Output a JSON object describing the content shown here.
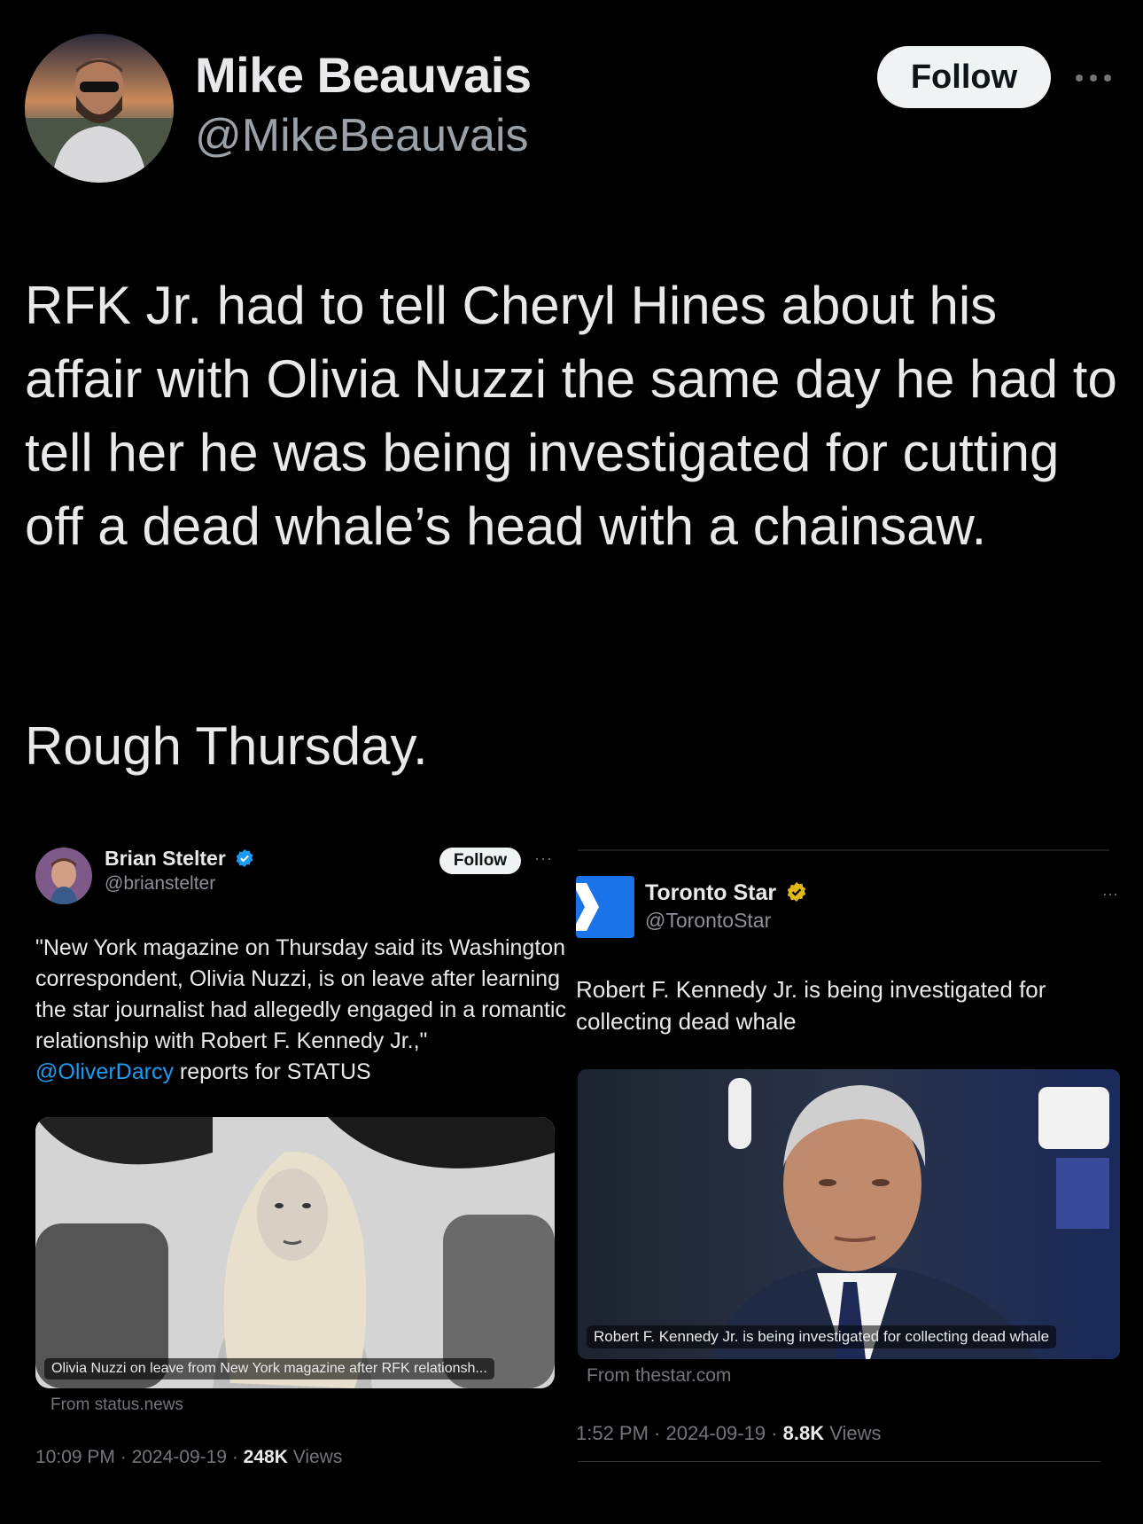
{
  "tweet": {
    "author_name": "Mike Beauvais",
    "author_handle": "@MikeBeauvais",
    "follow_label": "Follow",
    "text": "RFK Jr. had to tell Cheryl Hines about his affair with Olivia Nuzzi the same day he had to tell her he was being investigated for cutting off a dead whale’s head with a chainsaw.",
    "text_line2": "Rough Thursday."
  },
  "left_card": {
    "author_name": "Brian Stelter",
    "author_handle": "@brianstelter",
    "follow_label": "Follow",
    "text_before_link": "\"New York magazine on Thursday said its Washington correspondent, Olivia Nuzzi, is on leave after learning the star journalist had allegedly engaged in a romantic relationship with Robert F. Kennedy Jr.,\" ",
    "link_text": "@OliverDarcy",
    "text_after_link": " reports for STATUS",
    "image_caption": "Olivia Nuzzi on leave from New York magazine after RFK relationsh...",
    "from_source": "From status.news",
    "time": "10:09 PM",
    "date": "2024-09-19",
    "views_count": "248K",
    "views_label": "Views"
  },
  "right_card": {
    "author_name": "Toronto Star",
    "author_handle": "@TorontoStar",
    "text": "Robert F. Kennedy Jr. is being investigated for collecting dead whale",
    "image_caption": "Robert F. Kennedy Jr. is being investigated for collecting dead whale",
    "from_source": "From thestar.com",
    "time": "1:52 PM",
    "date": "2024-09-19",
    "views_count": "8.8K",
    "views_label": "Views"
  },
  "colors": {
    "background": "#000000",
    "text": "#e7e9ea",
    "secondary": "#71767b",
    "link": "#1d9bf0",
    "verified_blue": "#1d9bf0",
    "verified_gold": "#e2b719"
  }
}
